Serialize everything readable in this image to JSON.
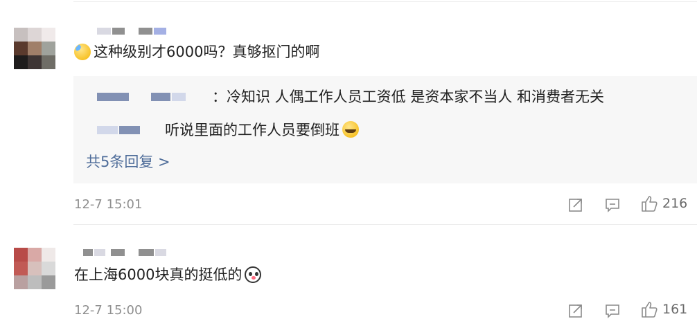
{
  "comments": [
    {
      "text": "这种级别才6000吗？真够抠门的啊",
      "emoji": "sweat-emoji",
      "replies": [
        {
          "text": "：冷知识 人偶工作人员工资低 是资本家不当人 和消费者无关"
        },
        {
          "text": "听说里面的工作人员要倒班",
          "emoji": "cry-laugh-emoji"
        }
      ],
      "more_replies": "共5条回复 >",
      "timestamp": "12-7 15:01",
      "icons": [
        "share-icon",
        "comment-icon",
        "like-icon"
      ],
      "likes": "216"
    },
    {
      "text": "在上海6000块真的挺低的",
      "emoji": "panda-emoji",
      "timestamp": "12-7 15:00",
      "icons": [
        "share-icon",
        "comment-icon",
        "like-icon"
      ],
      "likes": "161"
    }
  ]
}
